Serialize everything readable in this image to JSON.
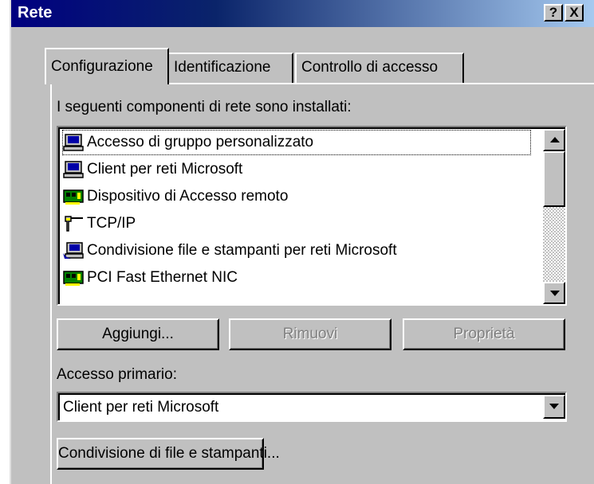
{
  "window": {
    "title": "Rete",
    "help_button": "?",
    "close_button": "X"
  },
  "tabs": [
    {
      "label": "Configurazione",
      "active": true
    },
    {
      "label": "Identificazione",
      "active": false
    },
    {
      "label": "Controllo di accesso",
      "active": false
    }
  ],
  "components": {
    "label": "I seguenti componenti di rete sono installati:",
    "items": [
      {
        "label": "Accesso di gruppo personalizzato",
        "icon": "computer-icon"
      },
      {
        "label": "Client per reti Microsoft",
        "icon": "computer-icon"
      },
      {
        "label": "Dispositivo di Accesso remoto",
        "icon": "network-card-icon"
      },
      {
        "label": "TCP/IP",
        "icon": "protocol-icon"
      },
      {
        "label": "Condivisione file e stampanti per reti Microsoft",
        "icon": "shared-computer-icon"
      },
      {
        "label": "PCI Fast Ethernet NIC",
        "icon": "network-card-icon"
      }
    ]
  },
  "buttons": {
    "add": "Aggiungi...",
    "remove": "Rimuovi",
    "properties": "Proprietà"
  },
  "primary_logon": {
    "label": "Accesso primario:",
    "value": "Client per reti Microsoft"
  },
  "sharing_button": "Condivisione di file e stampanti...",
  "colors": {
    "titlebar_start": "#000080",
    "titlebar_end": "#a6caf0",
    "face": "#c0c0c0"
  }
}
